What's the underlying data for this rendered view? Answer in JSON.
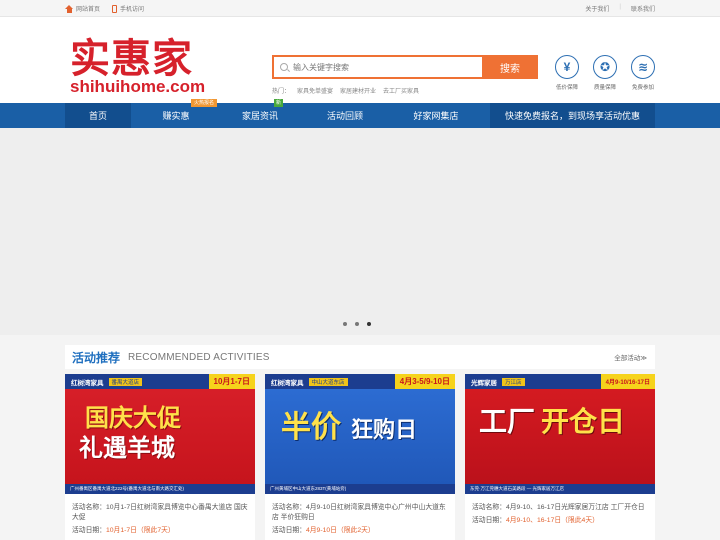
{
  "topbar": {
    "home_link": "网站首页",
    "mobile_link": "手机访问",
    "about": "关于我们",
    "contact": "联系我们"
  },
  "logo": {
    "cn": "实惠家",
    "en": "shihuihome.com"
  },
  "search": {
    "placeholder": "输入关键字搜索",
    "button": "搜索",
    "hot_label": "热门：",
    "hot_terms": [
      "家具免单盛宴",
      "家居建材开业",
      "去工厂买家具"
    ]
  },
  "badges": [
    {
      "icon": "yen-icon",
      "glyph": "¥",
      "label": "低价保障"
    },
    {
      "icon": "medal-icon",
      "glyph": "✪",
      "label": "质量保障"
    },
    {
      "icon": "coins-icon",
      "glyph": "≋",
      "label": "免费参加"
    }
  ],
  "nav": {
    "items": [
      {
        "label": "首页"
      },
      {
        "label": "赚实惠",
        "tag": "火热报名"
      },
      {
        "label": "家居资讯",
        "tag": "新"
      },
      {
        "label": "活动回顾"
      },
      {
        "label": "好家网集店"
      }
    ],
    "cta": "快速免费报名，到现场享活动优惠"
  },
  "banner": {
    "dots": 3,
    "active_dot": 2
  },
  "activities": {
    "title": "活动推荐",
    "title_en": "RECOMMENDED ACTIVITIES",
    "more": "全部活动≫",
    "name_label": "活动名称：",
    "date_label": "活动日期：",
    "cards": [
      {
        "poster_brand": "红树湾家具",
        "poster_sub": "番禺大道店",
        "poster_date": "10月1-7日",
        "poster_headline_1": "国庆大促",
        "poster_headline_2": "礼遇羊城",
        "poster_footer": "广州番禺区番禺大道北222号(番禺大道北与南大路交汇处)",
        "name": "10月1-7日红树湾家具博览中心番禺大道店 国庆大促",
        "date": "10月1-7日",
        "remain": "（限此7天）"
      },
      {
        "poster_brand": "红树湾家具",
        "poster_sub": "中山大道东店",
        "poster_date": "4月3-5/9-10日",
        "poster_headline_1": "半价",
        "poster_headline_2": "狂购日",
        "poster_footer": "广州黄埔区中山大道东283T(黄埔站旁)",
        "name": "4月9-10日红树湾家具博览中心广州中山大道东店 半价狂购日",
        "date": "4月9-10日",
        "remain": "（限此2天）"
      },
      {
        "poster_brand": "光辉家居",
        "poster_sub": "万江店",
        "poster_date": "4月9-10/16-17日",
        "poster_headline_1": "工厂",
        "poster_headline_2": "开仓日",
        "poster_footer": "东莞·万江莞穗大道石美路段 — 光辉家居万江店",
        "name": "4月9-10、16-17日光辉家居万江店 工厂开仓日",
        "date": "4月9-10、16-17日",
        "remain": "（限此4天）"
      }
    ]
  }
}
